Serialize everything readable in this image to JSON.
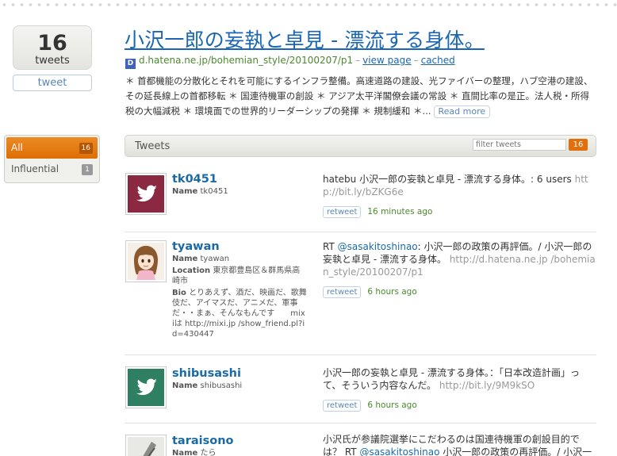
{
  "sidebar": {
    "count": "16",
    "count_label": "tweets",
    "tweet_button": "tweet",
    "filters": [
      {
        "label": "All",
        "count": "16"
      },
      {
        "label": "Influential",
        "count": "1"
      }
    ]
  },
  "entry": {
    "title": "小沢一郎の妄執と卓見 - 漂流する身体。",
    "favicon_letter": "D",
    "domain": "d.hatena.ne.jp/bohemian_style/20100207/p1",
    "view_page": "view page",
    "cached": "cached",
    "description": "＊ 首都機能の分散化とそれを可能にするインフラ整備。高速道路の建設、光ファイバーの整理，ハブ空港の建設、その延長線上の首都移転 ＊ 国連待機軍の創設 ＊ アジア太平洋閣僚会議の常設 ＊ 直間比率の是正。法人税・所得税の大幅減税 ＊ 環境面での世界的リーダーシップの発揮 ＊ 規制緩和 ＊...",
    "read_more": "Read more"
  },
  "tweets_header": {
    "title": "Tweets",
    "filter_placeholder": "filter tweets",
    "count": "16"
  },
  "tweets": [
    {
      "username": "tk0451",
      "name_label": "Name",
      "name": "tk0451",
      "text": "hatebu 小沢一郎の妄執と卓見 - 漂流する身体。: 6 users ",
      "link": "http://bit.ly/bZKG6e",
      "retweet": "retweet",
      "time": "16 minutes ago"
    },
    {
      "username": "tyawan",
      "name_label": "Name",
      "name": "tyawan",
      "location_label": "Location",
      "location": "東京都豊島区＆群馬県高崎市",
      "bio_label": "Bio",
      "bio": "とりあえず、酒だ、映画だ、歌舞伎だ、アイマスだ、アニメだ、軍事だ・・まぁ、そんなもんです　　mixiは http://mixi.jp /show_friend.pl?id=430447",
      "text_prefix": "RT ",
      "mention": "@sasakitoshinao",
      "text": ": 小沢一郎の政策の再評価。/ 小沢一郎の妄執と卓見 - 漂流する身体。 ",
      "link": "http://d.hatena.ne.jp /bohemian_style/20100207/p1",
      "retweet": "retweet",
      "time": "6 hours ago"
    },
    {
      "username": "shibusashi",
      "name_label": "Name",
      "name": "shibusashi",
      "text": "小沢一郎の妄執と卓見 - 漂流する身体。：「日本改造計画」って、そういう内容なんだ。 ",
      "link": "http://bit.ly/9M9kSO",
      "retweet": "retweet",
      "time": "6 hours ago"
    },
    {
      "username": "taraisono",
      "name_label": "Name",
      "name": "たら",
      "text": "小沢氏が参議院選挙にこだわるのは国連待機軍の創設目的では？ RT ",
      "mention": "@sasakitoshinao",
      "text_suffix": " 小沢一郎の政策の再評価。/ 小沢一郎の"
    }
  ],
  "colors": {
    "link": "#1a66b3",
    "accent": "#e26f0b",
    "time": "#4a8a2e",
    "twitter_avatar_1": "#8b2942",
    "twitter_avatar_3": "#2f7f62"
  }
}
